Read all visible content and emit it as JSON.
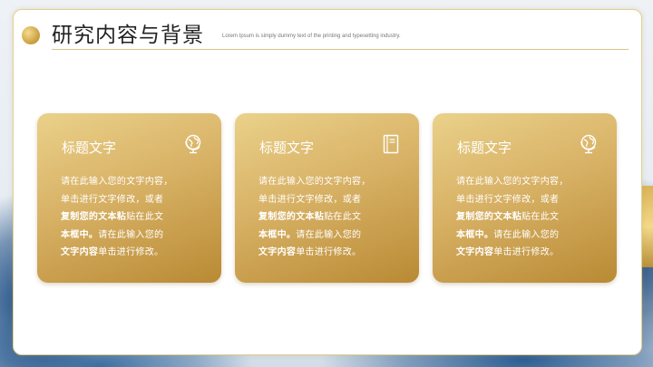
{
  "header": {
    "title": "研究内容与背景",
    "subtitle": "Lorem Ipsum is simply dummy text of the printing and typesetting industry."
  },
  "cards": [
    {
      "title": "标题文字",
      "icon": "globe-icon",
      "line1": "请在此输入您的文字内容，",
      "line2": "单击进行文字修改，或者",
      "bold1": "复制您的文本粘",
      "line3": "贴在此文",
      "bold2": "本框中。",
      "line4": "请在此输入您的",
      "bold3": "文字内容",
      "line5": "单击进行修改。"
    },
    {
      "title": "标题文字",
      "icon": "book-icon",
      "line1": "请在此输入您的文字内容，",
      "line2": "单击进行文字修改，或者",
      "bold1": "复制您的文本粘",
      "line3": "贴在此文",
      "bold2": "本框中。",
      "line4": "请在此输入您的",
      "bold3": "文字内容",
      "line5": "单击进行修改。"
    },
    {
      "title": "标题文字",
      "icon": "globe-icon",
      "line1": "请在此输入您的文字内容，",
      "line2": "单击进行文字修改，或者",
      "bold1": "复制您的文本粘",
      "line3": "贴在此文",
      "bold2": "本框中。",
      "line4": "请在此输入您的",
      "bold3": "文字内容",
      "line5": "单击进行修改。"
    }
  ],
  "colors": {
    "gold_light": "#ead18a",
    "gold_dark": "#b98a34",
    "accent_blue": "#1f4f86"
  }
}
